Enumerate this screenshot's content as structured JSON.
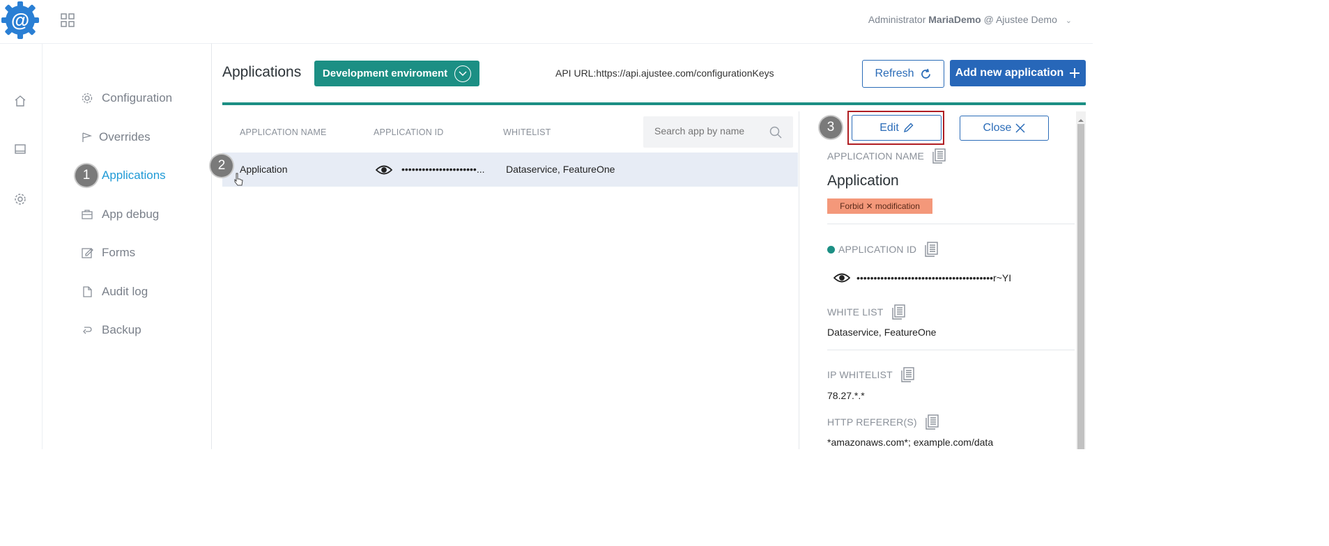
{
  "header": {
    "user_role": "Administrator",
    "user_name": "MariaDemo",
    "org": "@ Ajustee Demo"
  },
  "nav": {
    "items": [
      {
        "label": "Configuration",
        "icon": "gear-icon"
      },
      {
        "label": "Overrides",
        "icon": "flag-icon"
      },
      {
        "label": "Applications",
        "icon": "apps-icon"
      },
      {
        "label": "App debug",
        "icon": "briefcase-icon"
      },
      {
        "label": "Forms",
        "icon": "edit-icon"
      },
      {
        "label": "Audit log",
        "icon": "file-icon"
      },
      {
        "label": "Backup",
        "icon": "undo-icon"
      }
    ],
    "active": "Applications"
  },
  "steps": {
    "one": "1",
    "two": "2",
    "three": "3"
  },
  "main": {
    "title": "Applications",
    "environment": "Development enviroment",
    "api_url": "API URL:https://api.ajustee.com/configurationKeys",
    "refresh_label": "Refresh",
    "add_label": "Add new application",
    "columns": [
      "APPLICATION NAME",
      "APPLICATION ID",
      "WHITELIST"
    ],
    "search_placeholder": "Search app by name",
    "rows": [
      {
        "name": "Application",
        "id": "••••••••••••••••••••••...",
        "whitelist": "Dataservice, FeatureOne"
      }
    ]
  },
  "detail": {
    "edit_label": "Edit",
    "close_label": "Close",
    "app_name_label": "APPLICATION NAME",
    "app_name": "Application",
    "forbid_label": "Forbid ✕ modification",
    "app_id_label": "APPLICATION ID",
    "app_id": "••••••••••••••••••••••••••••••••••••••••r~YI",
    "white_list_label": "WHITE LIST",
    "white_list": "Dataservice, FeatureOne",
    "ip_whitelist_label": "IP WHITELIST",
    "ip_whitelist": "78.27.*.*",
    "http_referer_label": "HTTP REFERER(S)",
    "http_referer": "*amazonaws.com*; example.com/data"
  },
  "colors": {
    "teal": "#1c8f84",
    "blue": "#2767b9",
    "active_nav": "#1f9ad6",
    "forbid_badge": "#f4987a",
    "highlight_border": "#b01e23"
  }
}
